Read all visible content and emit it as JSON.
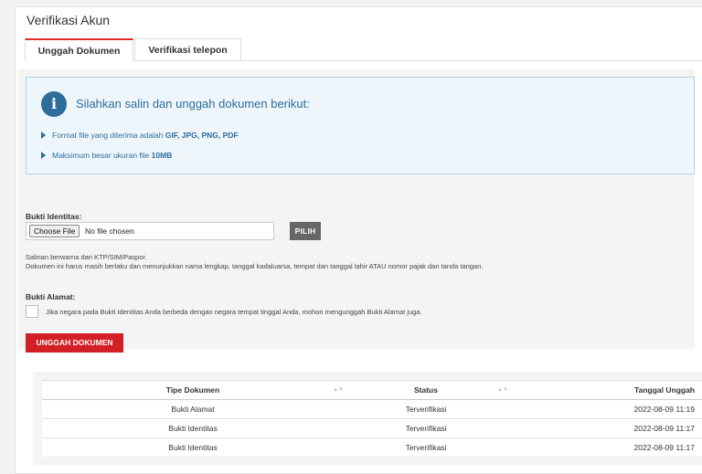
{
  "page": {
    "title": "Verifikasi Akun"
  },
  "tabs": [
    {
      "label": "Unggah Dokumen"
    },
    {
      "label": "Verifikasi telepon"
    }
  ],
  "info": {
    "icon": "info-icon",
    "title": "Silahkan salin dan unggah dokumen berikut:",
    "line1_text": "Format file yang diterima adalah ",
    "line1_bold": "GIF, JPG, PNG, PDF",
    "line2_text": "Maksimum besar ukuran file ",
    "line2_bold": "10MB"
  },
  "identity": {
    "label": "Bukti Identitas:",
    "choose_label": "Choose File",
    "file_status": "No file chosen",
    "pilih_label": "PILIH",
    "note1": "Salinan berwarna dari KTP/SIM/Paspor.",
    "note2": "Dokumen ini harus masih berlaku dan menunjukkan nama lengkap, tanggal kadaluarsa, tempat dan tanggal lahir ATAU nomor pajak dan tanda tangan."
  },
  "address": {
    "label": "Bukti Alamat:",
    "checkbox_text": "Jika negara pada Bukti Identitas Anda berbeda dengan negara tempat tinggal Anda, mohon mengunggah Bukti Alamat juga."
  },
  "upload_button": "UNGGAH DOKUMEN ANDA",
  "table": {
    "headers": [
      "Tipe Dokumen",
      "Status",
      "Tanggal Unggah"
    ],
    "rows": [
      [
        "Bukti Alamat",
        "Terverifikasi",
        "2022-08-09 11:19"
      ],
      [
        "Bukti Identitas",
        "Terverifikasi",
        "2022-08-09 11:17"
      ],
      [
        "Bukti Identitas",
        "Terverifikasi",
        "2022-08-09 11:17"
      ]
    ]
  },
  "colors": {
    "accent": "#d32026",
    "info": "#2e6c9c"
  }
}
